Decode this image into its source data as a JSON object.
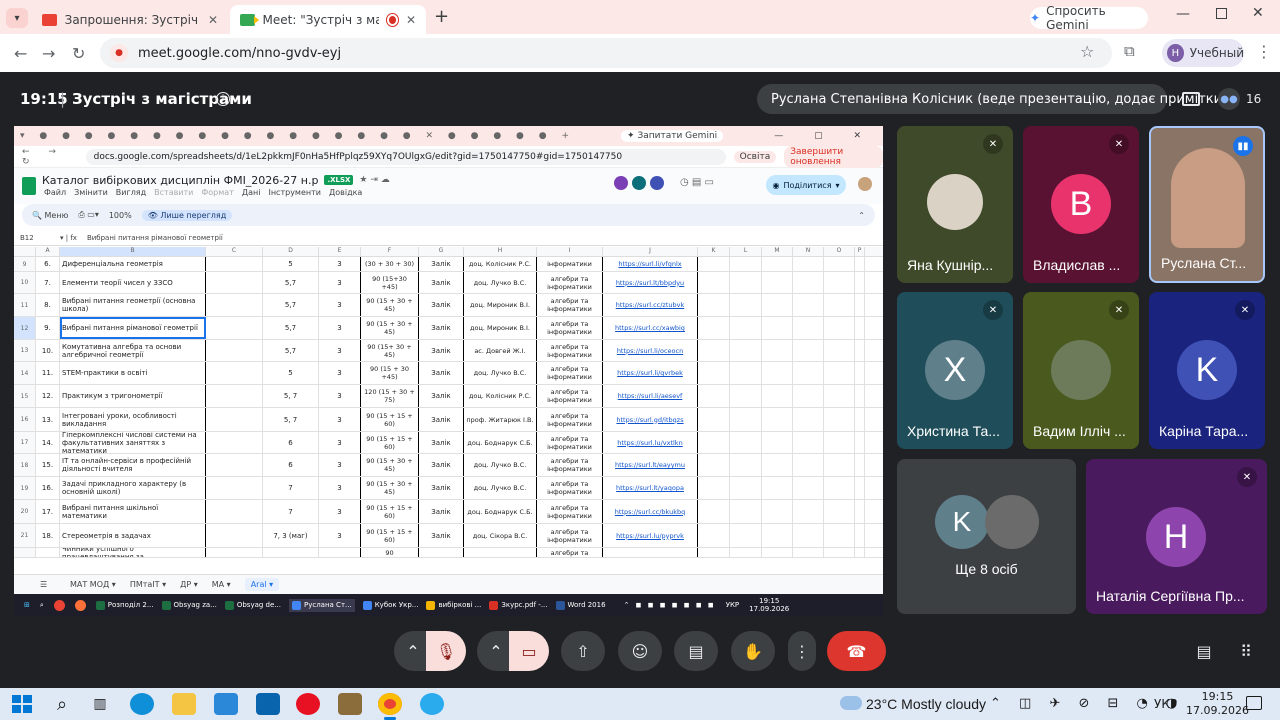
{
  "browser": {
    "tabs": [
      {
        "title": "Запрошення: Зустріч з магістр"
      },
      {
        "title": "Meet: \"Зустріч з магістрам"
      }
    ],
    "gemini_label": "Спросить Gemini",
    "url": "meet.google.com/nno-gvdv-eyj",
    "profile_label": "Учебный",
    "profile_initial": "H"
  },
  "meet": {
    "time": "19:15",
    "separator": "|",
    "title": "Зустріч з магістрами",
    "presenter": "Руслана Степанівна Колісник (веде презентацію, додає примітки)",
    "participants_count": "16",
    "tiles": [
      {
        "name": "Яна Кушнір...",
        "muted": true
      },
      {
        "name": "Владислав ...",
        "initial": "В",
        "muted": true,
        "color": "#e8336d"
      },
      {
        "name": "Руслана Ст...",
        "speaking": true
      },
      {
        "name": "Христина Та...",
        "initial": "Х",
        "muted": true,
        "color": "#5f7f8b"
      },
      {
        "name": "Вадим Ілліч ...",
        "muted": true
      },
      {
        "name": "Каріна Тара...",
        "initial": "K",
        "muted": true,
        "color": "#3f51b5"
      },
      {
        "name": "Ще 8 осіб",
        "initial": "K"
      },
      {
        "name": "Наталія Сергіївна Пр...",
        "initial": "H",
        "muted": true,
        "color": "#8e44ad"
      }
    ]
  },
  "shared": {
    "inner_url": "docs.google.com/spreadsheets/d/1eL2pkkmJF0nHa5HfPplqz59XYq7OUlgxG/edit?gid=1750147750#gid=1750147750",
    "inner_gemini": "Запитати Gemini",
    "inner_profile": "Освіта",
    "inner_update": "Завершити оновлення",
    "doc_title": "Каталог вибіркових дисциплін ФМІ_2026-27 н.р",
    "doc_badge": ".XLSX",
    "menu": [
      "Файл",
      "Змінити",
      "Вигляд",
      "Вставити",
      "Формат",
      "Дані",
      "Інструменти",
      "Довідка"
    ],
    "toolbar_menu": "Меню",
    "zoom": "100%",
    "view_only": "Лише перегляд",
    "share_label": "Поділитися",
    "cell_ref": "B12",
    "formula": "Вибрані питання ріманової геометрії",
    "columns": [
      "A",
      "B",
      "C",
      "D",
      "E",
      "F",
      "G",
      "H",
      "I",
      "J",
      "K",
      "L",
      "M",
      "N",
      "O",
      "P"
    ],
    "rows": [
      {
        "rn": "9",
        "a": "6.",
        "b": "Диференціальна геометрія",
        "d": "5",
        "e": "3",
        "f": "(30 + 30 + 30)",
        "g": "Залік",
        "h": "доц. Колісник Р.С.",
        "i": "інформатики",
        "j": "https://surl.li/vfgnlx"
      },
      {
        "rn": "10",
        "a": "7.",
        "b": "Елементи теорії чисел у ЗЗСО",
        "d": "5,7",
        "e": "3",
        "f": "90 (15+30 +45)",
        "g": "Залік",
        "h": "доц. Лучко В.С.",
        "i": "алгебри та інформатики",
        "j": "https://surl.lt/bbpdyu"
      },
      {
        "rn": "11",
        "a": "8.",
        "b": "Вибрані питання геометрії (основна школа)",
        "d": "5,7",
        "e": "3",
        "f": "90 (15 + 30 + 45)",
        "g": "Залік",
        "h": "доц. Мироник В.І.",
        "i": "алгебри та інформатики",
        "j": "https://surl.cc/ztubvk"
      },
      {
        "rn": "12",
        "a": "9.",
        "b": "Вибрані питання ріманової геометрії",
        "d": "5,7",
        "e": "3",
        "f": "90 (15 + 30 + 45)",
        "g": "Залік",
        "h": "доц. Мироник В.І.",
        "i": "алгебри та інформатики",
        "j": "https://surl.cc/xawbig"
      },
      {
        "rn": "13",
        "a": "10.",
        "b": "Комутативна алгебра та основи алгебричної геометрії",
        "d": "5,7",
        "e": "3",
        "f": "90 (15+ 30 + 45)",
        "g": "Залік",
        "h": "ас. Довгей Ж.І.",
        "i": "алгебри та інформатики",
        "j": "https://surl.li/oceocn"
      },
      {
        "rn": "14",
        "a": "11.",
        "b": "STEM-практики в освіті",
        "d": "5",
        "e": "3",
        "f": "90 (15 + 30 +45)",
        "g": "Залік",
        "h": "доц. Лучко В.С.",
        "i": "алгебри та інформатики",
        "j": "https://surl.li/gvrbek"
      },
      {
        "rn": "15",
        "a": "12.",
        "b": "Практикум з тригонометрії",
        "d": "5, 7",
        "e": "3",
        "f": "120 (15 + 30 + 75)",
        "g": "Залік",
        "h": "доц. Колісник Р.С.",
        "i": "алгебри та інформатики",
        "j": "https://surl.li/aesevf"
      },
      {
        "rn": "16",
        "a": "13.",
        "b": "Інтегровані уроки, особливості викладання",
        "d": "5, 7",
        "e": "3",
        "f": "90 (15 + 15 + 60)",
        "g": "Залік",
        "h": "проф. Житарюк І.В.",
        "i": "алгебри та інформатики",
        "j": "https://surl.gd/itbqzs"
      },
      {
        "rn": "17",
        "a": "14.",
        "b": "Гіперкомплексні числові системи на факультативних заняттях з математики",
        "d": "6",
        "e": "3",
        "f": "90 (15 + 15 + 60)",
        "g": "Залік",
        "h": "доц. Боднарук С.Б.",
        "i": "алгебри та інформатики",
        "j": "https://surl.lu/vxtlkn"
      },
      {
        "rn": "18",
        "a": "15.",
        "b": "ІТ та онлайн-сервіси в професійній діяльності вчителя",
        "d": "6",
        "e": "3",
        "f": "90 (15 + 30 + 45)",
        "g": "Залік",
        "h": "доц. Лучко В.С.",
        "i": "алгебри та інформатики",
        "j": "https://surl.lt/eayymu"
      },
      {
        "rn": "19",
        "a": "16.",
        "b": "Задачі прикладного характеру (в основній школі)",
        "d": "7",
        "e": "3",
        "f": "90 (15 + 30 + 45)",
        "g": "Залік",
        "h": "доц. Лучко В.С.",
        "i": "алгебри та інформатики",
        "j": "https://surl.lt/yaqopa"
      },
      {
        "rn": "20",
        "a": "17.",
        "b": "Вибрані питання шкільної математики",
        "d": "7",
        "e": "3",
        "f": "90 (15 + 15 + 60)",
        "g": "Залік",
        "h": "доц. Боднарук С.Б.",
        "i": "алгебри та інформатики",
        "j": "https://surl.cc/bkukbq"
      },
      {
        "rn": "21",
        "a": "18.",
        "b": "Стереометрія в задачах",
        "d": "7, 3 (маг)",
        "e": "3",
        "f": "90 (15 + 15 + 60)",
        "g": "Залік",
        "h": "доц. Сікора В.С.",
        "i": "алгебри та інформатики",
        "j": "https://surl.lu/pyprvk"
      },
      {
        "rn": "",
        "a": "",
        "b": "Чинники успішного працевлаштування за",
        "d": "",
        "e": "",
        "f": "90",
        "g": "",
        "h": "",
        "i": "алгебри та",
        "j": ""
      }
    ],
    "sheet_tabs": [
      "МАТ МОД",
      "ПМтаІТ",
      "ДР",
      "МА",
      "Aral"
    ],
    "inner_taskbar": [
      {
        "label": "Розподіл 2...",
        "color": "#1d6f42"
      },
      {
        "label": "Obsyag za...",
        "color": "#1d6f42"
      },
      {
        "label": "Obsyag de...",
        "color": "#1d6f42"
      },
      {
        "label": "Руслана Ст...",
        "color": "#4285f4"
      },
      {
        "label": "Кубок Укр...",
        "color": "#4285f4"
      },
      {
        "label": "вибіркові ...",
        "color": "#f4b400"
      },
      {
        "label": "Зкурс.pdf -...",
        "color": "#d93025"
      },
      {
        "label": "Word 2016",
        "color": "#2b579a"
      }
    ],
    "inner_clock": "19:15",
    "inner_date": "17.09.2026",
    "inner_lang": "УКР"
  },
  "taskbar": {
    "weather": "23°C Mostly cloudy",
    "lang": "УКР",
    "time": "19:15",
    "date": "17.09.2026"
  }
}
